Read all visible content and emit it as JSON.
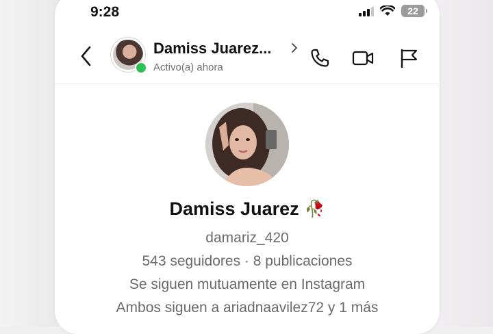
{
  "status_bar": {
    "time": "9:28",
    "battery": "22"
  },
  "header": {
    "name": "Damiss Juarez...",
    "status": "Activo(a) ahora",
    "icons": [
      "back-icon",
      "phone-icon",
      "video-icon",
      "flag-icon"
    ]
  },
  "profile": {
    "name": "Damiss Juarez",
    "emoji": "🥀",
    "username": "damariz_420",
    "stats": "543 seguidores · 8 publicaciones",
    "mutual": "Se siguen mutuamente en Instagram",
    "followers_in_common": "Ambos siguen a ariadnaavilez72 y 1 más"
  },
  "colors": {
    "online": "#2bc253",
    "text_primary": "#111111",
    "text_secondary": "#6a6a6a"
  }
}
